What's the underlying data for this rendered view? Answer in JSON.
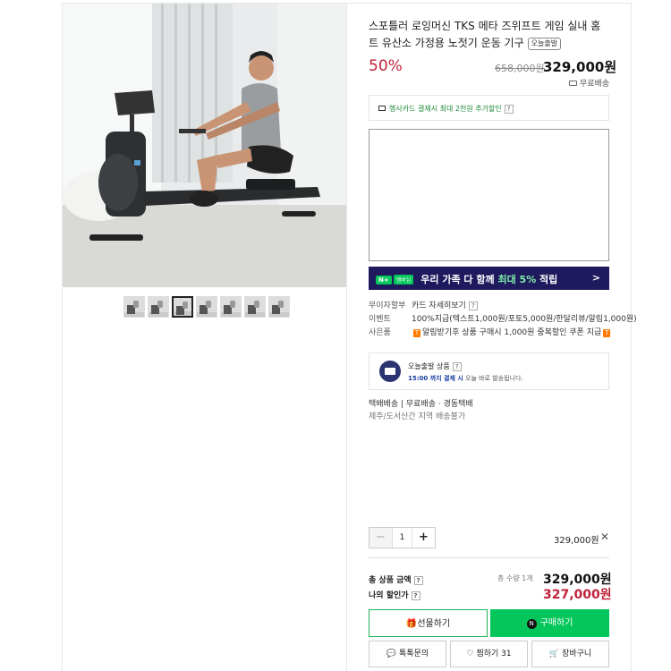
{
  "product": {
    "title": "스포틀러 로잉머신 TKS 메타 즈위프트 게임 실내 홈트 유산소 가정용 노젓기 운동 기구",
    "badge": "오늘출발",
    "discount_rate": "50%",
    "original_price": "658,000원",
    "price": "329,000원",
    "shipping": "무료배송"
  },
  "card_promo": {
    "text": "행사카드 결제시 최대 2천원 추가할인",
    "help": "?"
  },
  "naver_banner": {
    "np": "N+",
    "membership": "멤버십",
    "text_prefix": "우리 가족 다 함께 ",
    "text_highlight": "최대 5%",
    "text_suffix": " 적립",
    "arrow": ">"
  },
  "info_rows": [
    {
      "label": "무이자할부",
      "value": "카드 자세히보기",
      "help": "?"
    },
    {
      "label": "이벤트",
      "value": "100%지급(텍스트1,000원/포토5,000원/한달리뷰/알림1,000원)"
    },
    {
      "label": "사은품",
      "pre": "T",
      "value": "알림받기후 상품 구매시 1,000원 중복할인 쿠폰 지급",
      "post": "T"
    }
  ],
  "today_shipping": {
    "title": "오늘출발 상품",
    "help": "?",
    "time": "15:00 까지 결제 시",
    "note": "오늘 바로 발송됩니다."
  },
  "delivery": {
    "line1": "택배배송  |  무료배송 · 경동택배",
    "line2": "제주/도서산간 지역 배송불가"
  },
  "quantity": {
    "minus": "−",
    "value": "1",
    "plus": "+"
  },
  "line_price": "329,000원",
  "remove": "✕",
  "totals": {
    "total_label": "총 상품 금액",
    "total_help": "?",
    "count": "총 수량 1개",
    "total_price": "329,000원",
    "my_label": "나의 할인가",
    "my_help": "?",
    "my_price": "327,000원"
  },
  "buttons": {
    "gift": "선물하기",
    "buy": "구매하기",
    "talk": "톡톡문의",
    "wish": "찜하기 31",
    "cart": "장바구니"
  }
}
